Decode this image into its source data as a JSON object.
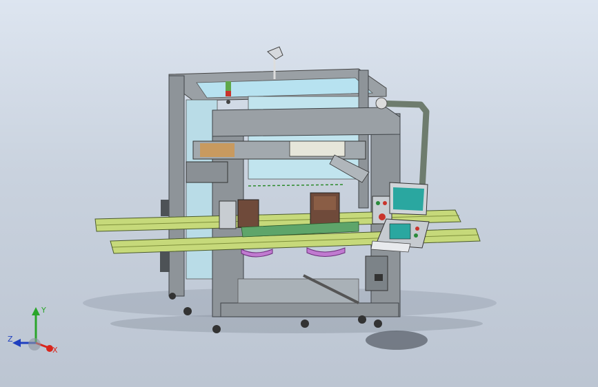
{
  "viewport": {
    "background": "#c9d2de"
  },
  "triad": {
    "x_label": "X",
    "y_label": "Y",
    "z_label": "Z",
    "x_color": "#d9261c",
    "y_color": "#2aa52a",
    "z_color": "#1f3fbf"
  },
  "model": {
    "frame_color": "#8e9499",
    "frame_dark": "#5d6368",
    "glass_color": "#b7e2f0",
    "rail_color": "#c6d97a",
    "fixture_color": "#6f4a3a",
    "plate_color": "#c07ad0",
    "hmi_screen_color": "#2aa7a0",
    "icons": [
      "machine-frame",
      "linear-rail",
      "gantry",
      "fixture",
      "hmi-panel",
      "signal-tower",
      "coordinate-triad"
    ]
  }
}
